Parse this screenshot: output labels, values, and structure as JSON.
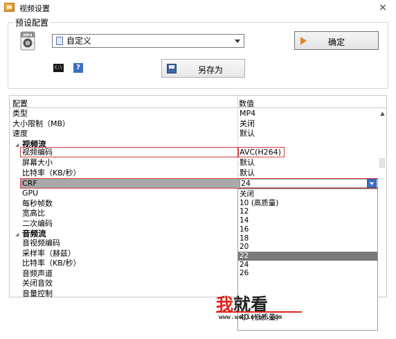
{
  "window": {
    "title": "视频设置",
    "close_glyph": "×"
  },
  "preset": {
    "group_label": "预设配置",
    "selected": "自定义",
    "ok_label": "确定",
    "save_as_label": "另存为",
    "cmd_icon_text": "C:\\",
    "help_icon_text": "?"
  },
  "grid": {
    "col_config": "配置",
    "col_value": "数值",
    "rows": [
      {
        "name": "类型",
        "value": "MP4"
      },
      {
        "name": "大小限制（MB）",
        "value": "关闭"
      },
      {
        "name": "速度",
        "value": "默认"
      },
      {
        "name": "视频流",
        "value": "",
        "category": true
      },
      {
        "name": "视频编码",
        "value": "AVC(H264)"
      },
      {
        "name": "屏幕大小",
        "value": "默认"
      },
      {
        "name": "比特率（KB/秒）",
        "value": "默认"
      },
      {
        "name": "CRF",
        "value": "24"
      },
      {
        "name": "GPU",
        "value": ""
      },
      {
        "name": "每秒帧数",
        "value": ""
      },
      {
        "name": "宽高比",
        "value": ""
      },
      {
        "name": "二次编码",
        "value": ""
      },
      {
        "name": "音频流",
        "value": "",
        "category": true
      },
      {
        "name": "音视频编码",
        "value": ""
      },
      {
        "name": "采样率（赫兹）",
        "value": ""
      },
      {
        "name": "比特率（KB/秒）",
        "value": ""
      },
      {
        "name": "音频声道",
        "value": ""
      },
      {
        "name": "关闭音效",
        "value": ""
      },
      {
        "name": "音量控制",
        "value": ""
      }
    ]
  },
  "crf_dropdown": {
    "options": [
      "关闭",
      "10 (高质量)",
      "12",
      "14",
      "16",
      "18",
      "20",
      "22",
      "24",
      "26",
      "",
      "",
      "",
      "",
      "40 (低质量)"
    ],
    "selected_index": 7
  },
  "watermark": {
    "logo_a": "我",
    "logo_b": "就看",
    "url": "www.wojiukan.com"
  }
}
